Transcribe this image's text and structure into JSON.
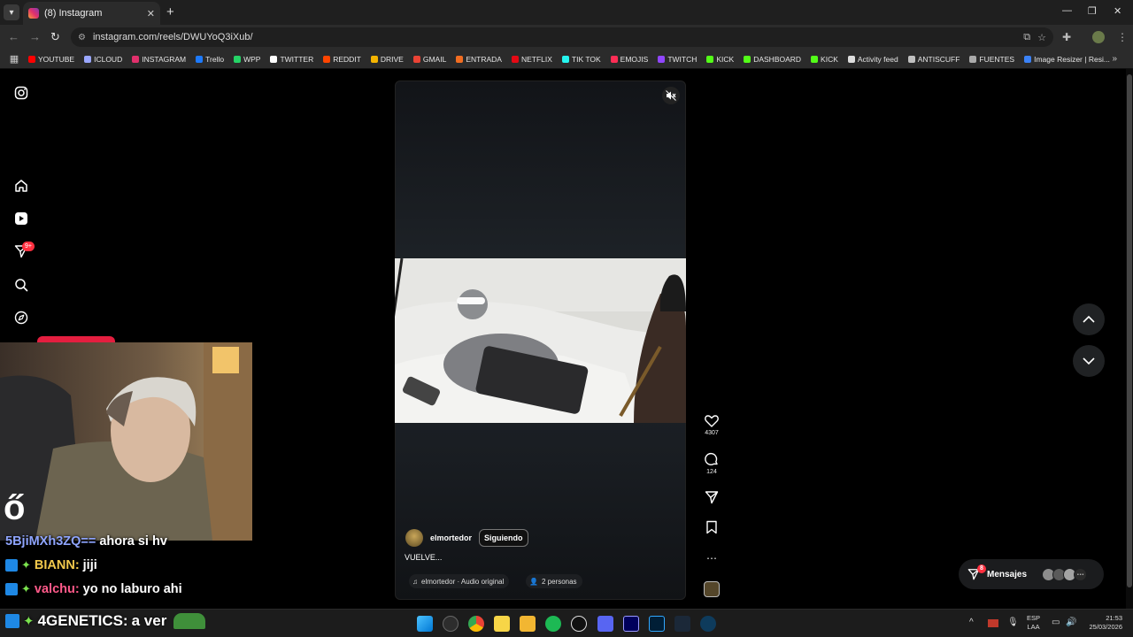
{
  "browser": {
    "tab": {
      "title": "(8) Instagram",
      "close": "✕"
    },
    "new_tab": "+",
    "window_controls": [
      "—",
      "❐",
      "✕"
    ],
    "nav": {
      "back": "←",
      "forward": "→",
      "reload": "↻"
    },
    "url": "instagram.com/reels/DWUYoQ3iXub/",
    "bookmarks_more": "»",
    "bookmarks": [
      {
        "label": "YOUTUBE",
        "color": "#ff0000"
      },
      {
        "label": "ICLOUD",
        "color": "#9aa7ff"
      },
      {
        "label": "INSTAGRAM",
        "color": "#e1306c"
      },
      {
        "label": "Trello",
        "color": "#1d7afc"
      },
      {
        "label": "WPP",
        "color": "#25d366"
      },
      {
        "label": "TWITTER",
        "color": "#ffffff"
      },
      {
        "label": "REDDIT",
        "color": "#ff4500"
      },
      {
        "label": "DRIVE",
        "color": "#f4b400"
      },
      {
        "label": "GMAIL",
        "color": "#ea4335"
      },
      {
        "label": "ENTRADA",
        "color": "#f26d21"
      },
      {
        "label": "NETFLIX",
        "color": "#e50914"
      },
      {
        "label": "TIK TOK",
        "color": "#25f4ee"
      },
      {
        "label": "EMOJIS",
        "color": "#ff2d55"
      },
      {
        "label": "TWITCH",
        "color": "#9146ff"
      },
      {
        "label": "KICK",
        "color": "#53fc18"
      },
      {
        "label": "DASHBOARD",
        "color": "#53fc18"
      },
      {
        "label": "KICK",
        "color": "#53fc18"
      },
      {
        "label": "Activity feed",
        "color": "#dddddd"
      },
      {
        "label": "ANTISCUFF",
        "color": "#c0c0c0"
      },
      {
        "label": "FUENTES",
        "color": "#aaaaaa"
      },
      {
        "label": "Image Resizer | Resi...",
        "color": "#3b82f6"
      }
    ]
  },
  "instagram": {
    "sidebar_badge": "9+",
    "reel": {
      "username": "elmortedor",
      "follow_label": "Siguiendo",
      "caption": "VUELVE...",
      "audio": "elmortedor · Audio original",
      "people": "2 personas",
      "likes": "4307",
      "comments": "124"
    },
    "messages": {
      "label": "Mensajes",
      "badge": "8"
    }
  },
  "stream_chat": {
    "lines": [
      {
        "user": "5BjiMXh3ZQ==",
        "text": "ahora si hv",
        "color": "#8fa5ff"
      },
      {
        "user": "BIANN:",
        "text": "jiji",
        "color": "#f2c94c"
      },
      {
        "user": "valchu:",
        "text": "yo no laburo ahi",
        "color": "#ff5a8a"
      }
    ],
    "highlight": {
      "user": "4GENETICS:",
      "text": "a ver"
    }
  },
  "taskbar": {
    "lang_top": "ESP",
    "lang_bottom": "LAA",
    "time": "21:53",
    "date": "25/03/2026"
  }
}
